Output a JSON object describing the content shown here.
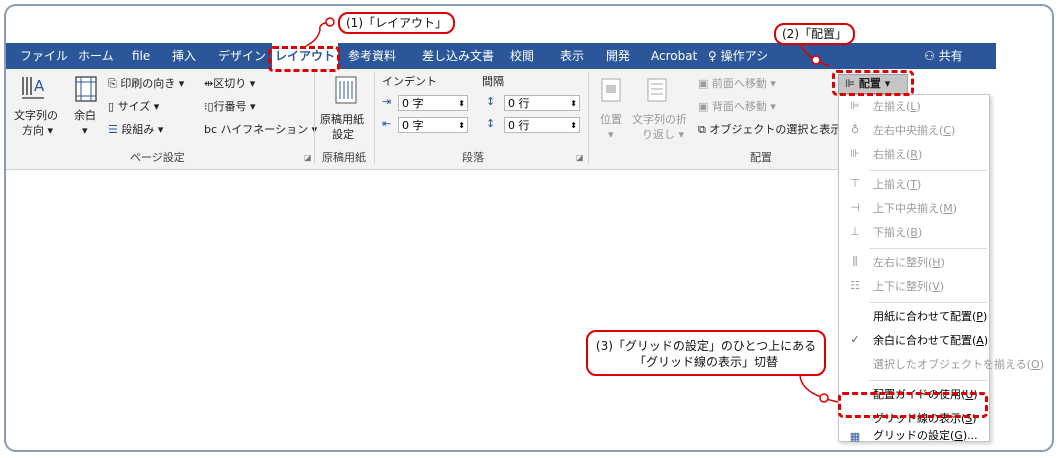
{
  "tabs": [
    {
      "label": "ファイル"
    },
    {
      "label": "ホーム"
    },
    {
      "label": "file"
    },
    {
      "label": "挿入"
    },
    {
      "label": "デザイン"
    },
    {
      "label": "レイアウト"
    },
    {
      "label": "参考資料"
    },
    {
      "label": "差し込み文書"
    },
    {
      "label": "校閲"
    },
    {
      "label": "表示"
    },
    {
      "label": "開発"
    },
    {
      "label": "Acrobat"
    }
  ],
  "tell_me": {
    "label": "操作アシ"
  },
  "share": {
    "label": "共有"
  },
  "page_setup": {
    "text_direction": [
      "文字列の",
      "方向"
    ],
    "margins": "余白",
    "orientation": "印刷の向き",
    "size": "サイズ",
    "columns": "段組み",
    "breaks": "区切り",
    "line_numbers": "行番号",
    "hyphenation": "ハイフネーション",
    "group_label": "ページ設定"
  },
  "manuscript": {
    "label": [
      "原稿用紙",
      "設定"
    ],
    "group_label": "原稿用紙"
  },
  "paragraph": {
    "indent_label": "インデント",
    "spacing_label": "間隔",
    "indent_left": "0 字",
    "indent_right": "0 字",
    "spacing_before": "0 行",
    "spacing_after": "0 行",
    "group_label": "段落"
  },
  "arrange": {
    "position": "位置",
    "wrap_text": [
      "文字列の折",
      "り返し"
    ],
    "bring_forward": "前面へ移動",
    "send_backward": "背面へ移動",
    "selection_pane": "オブジェクトの選択と表示",
    "align_button": "配置",
    "group_label": "配置"
  },
  "align_menu": [
    {
      "text": "左揃え",
      "key": "L",
      "enabled": false
    },
    {
      "text": "左右中央揃え",
      "key": "C",
      "enabled": false
    },
    {
      "text": "右揃え",
      "key": "R",
      "enabled": false
    },
    {
      "text": "上揃え",
      "key": "T",
      "enabled": false
    },
    {
      "text": "上下中央揃え",
      "key": "M",
      "enabled": false
    },
    {
      "text": "下揃え",
      "key": "B",
      "enabled": false
    },
    {
      "text": "左右に整列",
      "key": "H",
      "enabled": false
    },
    {
      "text": "上下に整列",
      "key": "V",
      "enabled": false
    },
    {
      "text": "用紙に合わせて配置",
      "key": "P",
      "enabled": true
    },
    {
      "text": "余白に合わせて配置",
      "key": "A",
      "enabled": true
    },
    {
      "text": "選択したオブジェクトを揃える",
      "key": "O",
      "enabled": false
    },
    {
      "text": "配置ガイドの使用",
      "key": "U",
      "enabled": true
    },
    {
      "text": "グリッド線の表示",
      "key": "S",
      "enabled": true
    },
    {
      "text": "グリッドの設定",
      "key": "G",
      "suffix": "...",
      "enabled": true
    }
  ],
  "callouts": {
    "c1": "(1)「レイアウト」",
    "c2": "(2)「配置」",
    "c3_line1": "(3)「グリッドの設定」のひとつ上にある",
    "c3_line2": "「グリッド線の表示」切替"
  },
  "colors": {
    "ribbon_blue": "#2b579a",
    "highlight_red": "#dd0000"
  }
}
